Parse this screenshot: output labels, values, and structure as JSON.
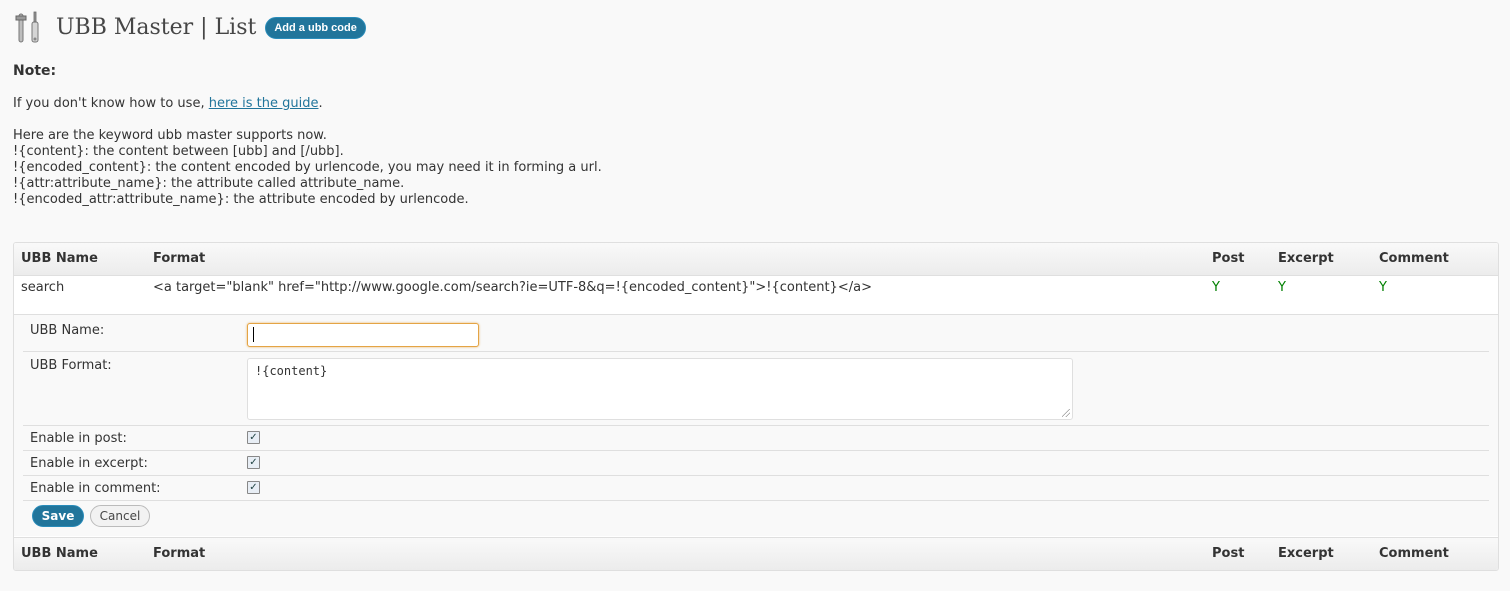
{
  "header": {
    "icon": "tools-icon",
    "title": "UBB Master | List",
    "add_button": "Add a ubb code"
  },
  "note": {
    "heading": "Note:",
    "guide_prefix": "If you don't know how to use, ",
    "guide_link": "here is the guide",
    "guide_suffix": ".",
    "keywords": [
      "Here are the keyword ubb master supports now.",
      "!{content}: the content between [ubb] and [/ubb].",
      "!{encoded_content}: the content encoded by urlencode, you may need it in forming a url.",
      "!{attr:attribute_name}: the attribute called attribute_name.",
      "!{encoded_attr:attribute_name}: the attribute encoded by urlencode."
    ]
  },
  "table": {
    "columns": [
      "UBB Name",
      "Format",
      "Post",
      "Excerpt",
      "Comment"
    ],
    "rows": [
      {
        "name": "search",
        "format": "<a target=\"blank\" href=\"http://www.google.com/search?ie=UTF-8&q=!{encoded_content}\">!{content}</a>",
        "post": "Y",
        "excerpt": "Y",
        "comment": "Y"
      }
    ]
  },
  "form": {
    "name_label": "UBB Name:",
    "name_value": "",
    "format_label": "UBB Format:",
    "format_value": "!{content}",
    "enable_post_label": "Enable in post:",
    "enable_post_checked": true,
    "enable_excerpt_label": "Enable in excerpt:",
    "enable_excerpt_checked": true,
    "enable_comment_label": "Enable in comment:",
    "enable_comment_checked": true,
    "save_label": "Save",
    "cancel_label": "Cancel"
  },
  "colors": {
    "accent": "#21759b",
    "yes": "#008000",
    "focus": "#e4a445"
  }
}
